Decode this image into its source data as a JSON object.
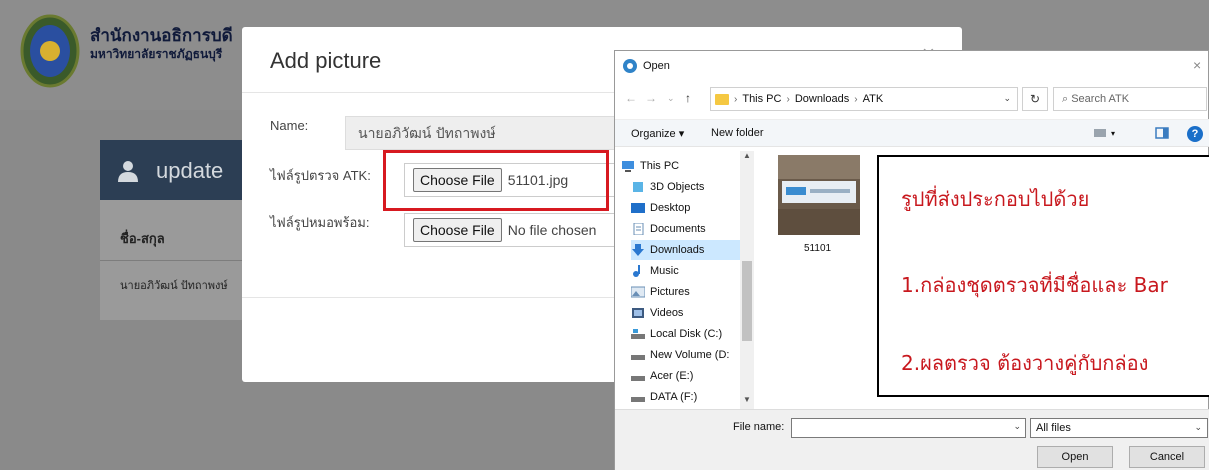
{
  "site": {
    "org_line1": "สำนักงานอธิการบดี",
    "org_line2": "มหาวิทยาลัยราชภัฏธนบุรี",
    "card_title": "update",
    "col_name_header": "ชื่อ-สกุล",
    "row_name": "นายอภิวัฒน์ ปัทถาพงษ์"
  },
  "modal": {
    "title": "Add picture",
    "close_glyph": "×",
    "name_label": "Name:",
    "name_value": "นายอภิวัฒน์ ปัทถาพงษ์",
    "atk_label": "ไฟล์รูปตรวจ ATK:",
    "atk_button": "Choose File",
    "atk_file": "51101.jpg",
    "mask_label": "ไฟล์รูปหมอพร้อม:",
    "mask_button": "Choose File",
    "mask_file": "No file chosen"
  },
  "dialog": {
    "title": "Open",
    "close_glyph": "×",
    "breadcrumb": [
      "This PC",
      "Downloads",
      "ATK"
    ],
    "search_placeholder": "Search ATK",
    "organize_label": "Organize ▾",
    "new_folder_label": "New folder",
    "help_glyph": "?",
    "nav_items": [
      {
        "label": "This PC",
        "icon": "pc-icon"
      },
      {
        "label": "3D Objects",
        "icon": "cube-icon"
      },
      {
        "label": "Desktop",
        "icon": "desktop-icon"
      },
      {
        "label": "Documents",
        "icon": "documents-icon"
      },
      {
        "label": "Downloads",
        "icon": "download-icon"
      },
      {
        "label": "Music",
        "icon": "music-icon"
      },
      {
        "label": "Pictures",
        "icon": "pictures-icon"
      },
      {
        "label": "Videos",
        "icon": "videos-icon"
      },
      {
        "label": "Local Disk (C:)",
        "icon": "disk-icon"
      },
      {
        "label": "New Volume (D:",
        "icon": "drive-icon"
      },
      {
        "label": "Acer (E:)",
        "icon": "drive-icon"
      },
      {
        "label": "DATA (F:)",
        "icon": "drive-icon"
      }
    ],
    "selected_nav": "Downloads",
    "file_name_label": "File name:",
    "file_name_value": "",
    "filter_value": "All files",
    "open_button": "Open",
    "cancel_button": "Cancel",
    "files": [
      {
        "name": "51101"
      }
    ]
  },
  "annotation": {
    "line1": "รูปที่ส่งประกอบไปด้วย",
    "line2": "1.กล่องชุดตรวจที่มีชื่อและ Bar",
    "line3": "2.ผลตรวจ ต้องวางคู่กับกล่อง",
    "color": "#c8181e"
  }
}
